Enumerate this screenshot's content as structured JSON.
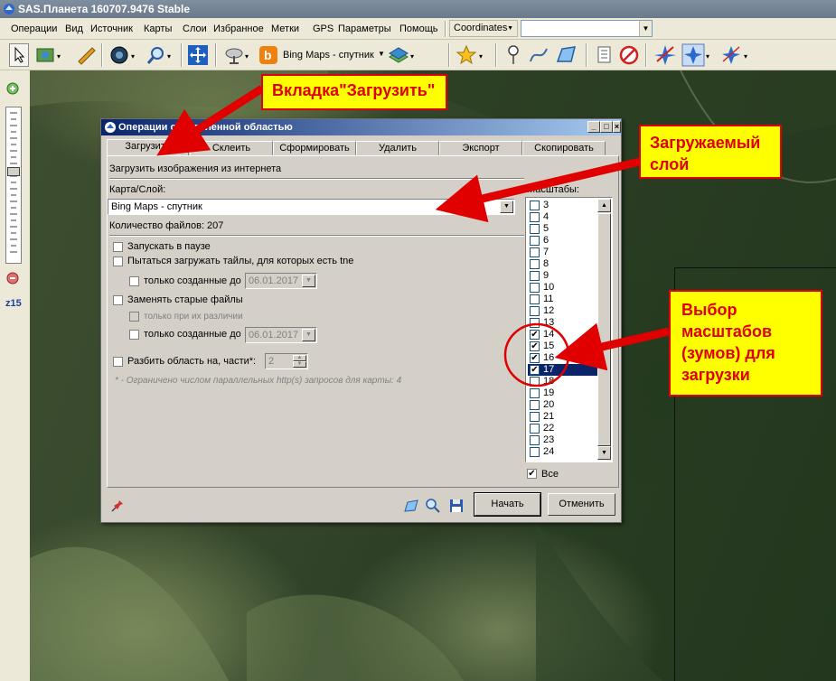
{
  "app": {
    "title": "SAS.Планета 160707.9476 Stable"
  },
  "menu": [
    "Операции",
    "Вид",
    "Источник",
    "Карты",
    "Слои",
    "Избранное",
    "Метки",
    "GPS",
    "Параметры",
    "Помощь"
  ],
  "coordinates": {
    "label": "Coordinates",
    "value": ""
  },
  "toolbar": {
    "map_label": "Bing Maps - спутник"
  },
  "left_panel": {
    "zoom_label": "z15"
  },
  "dialog": {
    "title": "Операции с выделенной областью",
    "tabs": [
      "Загрузить",
      "Склеить",
      "Сформировать",
      "Удалить",
      "Экспорт",
      "Скопировать"
    ],
    "heading": "Загрузить изображения из интернета",
    "map_layer_label": "Карта/Слой:",
    "map_layer_value": "Bing Maps - спутник",
    "file_count": "Количество файлов: 207",
    "options": {
      "start_paused": "Запускать в паузе",
      "try_tne": "Пытаться загружать тайлы, для которых есть tne",
      "only_created_before_1": "только созданные до",
      "date_1": "06.01.2017",
      "replace_old": "Заменять старые файлы",
      "only_if_different": "только при их различии",
      "only_created_before_2": "только созданные до",
      "date_2": "06.01.2017",
      "split_area": "Разбить область на, части*:",
      "split_value": "2",
      "note": "* - Ограничено числом параллельных http(s) запросов для карты: 4"
    },
    "scales_label": "Масштабы:",
    "scales": [
      {
        "label": "3",
        "checked": false
      },
      {
        "label": "4",
        "checked": false
      },
      {
        "label": "5",
        "checked": false
      },
      {
        "label": "6",
        "checked": false
      },
      {
        "label": "7",
        "checked": false
      },
      {
        "label": "8",
        "checked": false
      },
      {
        "label": "9",
        "checked": false
      },
      {
        "label": "10",
        "checked": false
      },
      {
        "label": "11",
        "checked": false
      },
      {
        "label": "12",
        "checked": false
      },
      {
        "label": "13",
        "checked": false
      },
      {
        "label": "14",
        "checked": true
      },
      {
        "label": "15",
        "checked": true
      },
      {
        "label": "16",
        "checked": true
      },
      {
        "label": "17",
        "checked": true
      },
      {
        "label": "18",
        "checked": false
      },
      {
        "label": "19",
        "checked": false
      },
      {
        "label": "20",
        "checked": false
      },
      {
        "label": "21",
        "checked": false
      },
      {
        "label": "22",
        "checked": false
      },
      {
        "label": "23",
        "checked": false
      },
      {
        "label": "24",
        "checked": false
      }
    ],
    "selected_scale": "17",
    "all_label": "Все",
    "start_button": "Начать",
    "cancel_button": "Отменить"
  },
  "annotations": {
    "tab_callout": "Вкладка\"Загрузить\"",
    "layer_callout": "Загружаемый слой",
    "zoom_callout": "Выбор масштабов (зумов) для загрузки"
  },
  "colors": {
    "callout_fill": "#ffff00",
    "callout_text": "#e00000",
    "selection": "#0a246a"
  }
}
